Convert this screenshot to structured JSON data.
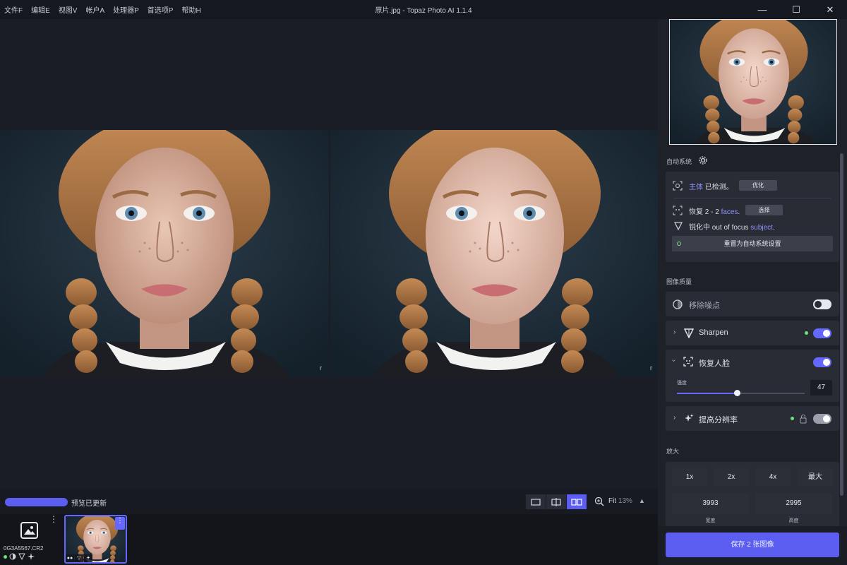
{
  "window": {
    "menu": [
      "文件F",
      "编辑E",
      "视图V",
      "帐户A",
      "处理器P",
      "首选项P",
      "帮助H"
    ],
    "title": "原片.jpg - Topaz Photo AI 1.1.4",
    "controls": {
      "minimize": "—",
      "maximize": "☐",
      "close": "✕"
    }
  },
  "preview": {
    "corner_mark_left": "r",
    "corner_mark_right": "r"
  },
  "status": {
    "progress": 1.0,
    "text": "预览已更新",
    "fit_label": "Fit",
    "zoom_pct": "13%",
    "collapse_icon": "▲",
    "view_mode_active": "side-by-side"
  },
  "filmstrip": {
    "more": "⋮",
    "file_name": "0G3A5567.CR2",
    "thumb_more": "⋮"
  },
  "panel": {
    "autopilot_label": "自动系统",
    "subject_link": "主体",
    "subject_text": " 已检测。",
    "optimize_btn": "优化",
    "recover_prefix": "恢复 2 - 2 ",
    "recover_link": "faces",
    "recover_suffix": ".",
    "select_btn": "选择",
    "sharpen_prefix": "锐化中 out of focus ",
    "sharpen_link": "subject",
    "sharpen_suffix": ".",
    "reset_btn": "重置为自动系统设置",
    "quality_label": "图像质量",
    "tools": {
      "denoise": {
        "label": "移除噪点",
        "enabled": false
      },
      "sharpen": {
        "label": "Sharpen",
        "enabled": true
      },
      "face": {
        "label": "恢复人脸",
        "enabled": true,
        "strength_label": "强度",
        "strength": 47
      },
      "upscale": {
        "label": "提高分辨率",
        "enabled": true
      }
    },
    "enlarge_label": "放大",
    "scales": [
      "1x",
      "2x",
      "4x",
      "最大"
    ],
    "width": "3993",
    "height": "2995",
    "width_label": "宽度",
    "height_label": "高度",
    "save_btn": "保存 2 张图像"
  },
  "colors": {
    "accent": "#5b5ef0",
    "panel_bg": "#1f2129",
    "canvas_bg": "#1b1d26",
    "active_dot": "#6ee17b"
  }
}
